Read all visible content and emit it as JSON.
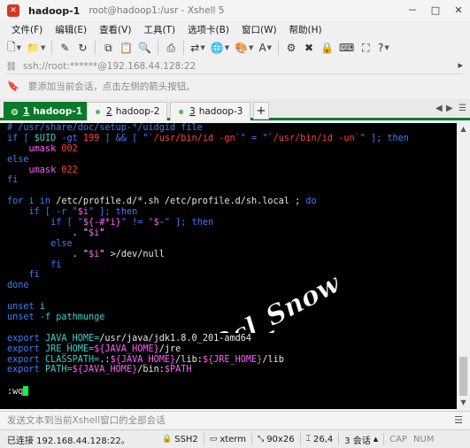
{
  "window": {
    "title": "hadoop-1",
    "path": "root@hadoop1:/usr - Xshell 5",
    "app_icon": "xshell-logo",
    "controls": [
      "－",
      "□",
      "✕"
    ]
  },
  "menu": [
    "文件(F)",
    "编辑(E)",
    "查看(V)",
    "工具(T)",
    "选项卡(B)",
    "窗口(W)",
    "帮助(H)"
  ],
  "address": {
    "text": "ssh://root:******@192.168.44.128:22"
  },
  "hint": {
    "text": "要添加当前会话，点击左侧的箭头按钮。"
  },
  "tabs": [
    {
      "num": "1",
      "label": "hadoop-1",
      "active": true
    },
    {
      "num": "2",
      "label": "hadoop-2",
      "active": false
    },
    {
      "num": "3",
      "label": "hadoop-3",
      "active": false
    }
  ],
  "terminal": {
    "lines": [
      [
        {
          "t": "# /usr/share/doc/setup-*/uidgid file",
          "c": "blue"
        }
      ],
      [
        {
          "t": "if [ ",
          "c": "blue"
        },
        {
          "t": "$UID",
          "c": "cyan"
        },
        {
          "t": " -gt ",
          "c": "blue"
        },
        {
          "t": "199",
          "c": "red"
        },
        {
          "t": " ] && [ \"",
          "c": "blue"
        },
        {
          "t": "`/usr/bin/id -gn`",
          "c": "red"
        },
        {
          "t": "\" = \"",
          "c": "blue"
        },
        {
          "t": "`/usr/bin/id -un`",
          "c": "red"
        },
        {
          "t": "\" ]; then",
          "c": "blue"
        }
      ],
      [
        {
          "t": "    umask ",
          "c": "magenta"
        },
        {
          "t": "002",
          "c": "red"
        }
      ],
      [
        {
          "t": "else",
          "c": "blue"
        }
      ],
      [
        {
          "t": "    umask ",
          "c": "magenta"
        },
        {
          "t": "022",
          "c": "red"
        }
      ],
      [
        {
          "t": "fi",
          "c": "blue"
        }
      ],
      [
        {
          "t": "",
          "c": "white"
        }
      ],
      [
        {
          "t": "for i in ",
          "c": "blue"
        },
        {
          "t": "/etc/profile.d/*.sh /etc/profile.d/sh.local ; ",
          "c": "white"
        },
        {
          "t": "do",
          "c": "blue"
        }
      ],
      [
        {
          "t": "    if [ -r \"",
          "c": "blue"
        },
        {
          "t": "$i",
          "c": "magenta"
        },
        {
          "t": "\" ]; then",
          "c": "blue"
        }
      ],
      [
        {
          "t": "        if [ \"",
          "c": "blue"
        },
        {
          "t": "${-#*i}",
          "c": "magenta"
        },
        {
          "t": "\" != \"",
          "c": "blue"
        },
        {
          "t": "$-",
          "c": "magenta"
        },
        {
          "t": "\" ]; then",
          "c": "blue"
        }
      ],
      [
        {
          "t": "            . \"",
          "c": "white"
        },
        {
          "t": "$i",
          "c": "magenta"
        },
        {
          "t": "\"",
          "c": "white"
        }
      ],
      [
        {
          "t": "        else",
          "c": "blue"
        }
      ],
      [
        {
          "t": "            . \"",
          "c": "white"
        },
        {
          "t": "$i",
          "c": "magenta"
        },
        {
          "t": "\" >/dev/null",
          "c": "white"
        }
      ],
      [
        {
          "t": "        fi",
          "c": "blue"
        }
      ],
      [
        {
          "t": "    fi",
          "c": "blue"
        }
      ],
      [
        {
          "t": "done",
          "c": "blue"
        }
      ],
      [
        {
          "t": "",
          "c": "white"
        }
      ],
      [
        {
          "t": "unset ",
          "c": "blue"
        },
        {
          "t": "i",
          "c": "cyan"
        }
      ],
      [
        {
          "t": "unset ",
          "c": "blue"
        },
        {
          "t": "-f pathmunge",
          "c": "cyan"
        }
      ],
      [
        {
          "t": "",
          "c": "white"
        }
      ],
      [
        {
          "t": "export ",
          "c": "blue"
        },
        {
          "t": "JAVA_HOME=",
          "c": "cyan"
        },
        {
          "t": "/usr/java/jdk1.8.0_201-amd64",
          "c": "white"
        }
      ],
      [
        {
          "t": "export ",
          "c": "blue"
        },
        {
          "t": "JRE_HOME=",
          "c": "cyan"
        },
        {
          "t": "${JAVA_HOME}",
          "c": "magenta"
        },
        {
          "t": "/jre",
          "c": "white"
        }
      ],
      [
        {
          "t": "export ",
          "c": "blue"
        },
        {
          "t": "CLASSPATH=",
          "c": "cyan"
        },
        {
          "t": ".:",
          "c": "white"
        },
        {
          "t": "${JAVA_HOME}",
          "c": "magenta"
        },
        {
          "t": "/lib:",
          "c": "white"
        },
        {
          "t": "${JRE_HOME}",
          "c": "magenta"
        },
        {
          "t": "/lib",
          "c": "white"
        }
      ],
      [
        {
          "t": "export ",
          "c": "blue"
        },
        {
          "t": "PATH=",
          "c": "cyan"
        },
        {
          "t": "${JAVA_HOME}",
          "c": "magenta"
        },
        {
          "t": "/bin:",
          "c": "white"
        },
        {
          "t": "$PATH",
          "c": "magenta"
        }
      ],
      [
        {
          "t": "",
          "c": "white"
        }
      ],
      [
        {
          "t": ":wq",
          "c": "white"
        }
      ]
    ],
    "cursor_color": "#00ff3c",
    "watermark": "Dcl_Snow"
  },
  "compose": {
    "placeholder": "发送文本到当前Xshell窗口的全部会话"
  },
  "status": {
    "connection": "已连接 192.168.44.128:22。",
    "protocol": "SSH2",
    "term": "xterm",
    "size": "90x26",
    "cursor": "26,4",
    "sessions": "3 会话",
    "caps": "CAP",
    "num": "NUM"
  },
  "colors": {
    "tab_active": "#0a7a2a",
    "app_icon": "#d9341f"
  }
}
